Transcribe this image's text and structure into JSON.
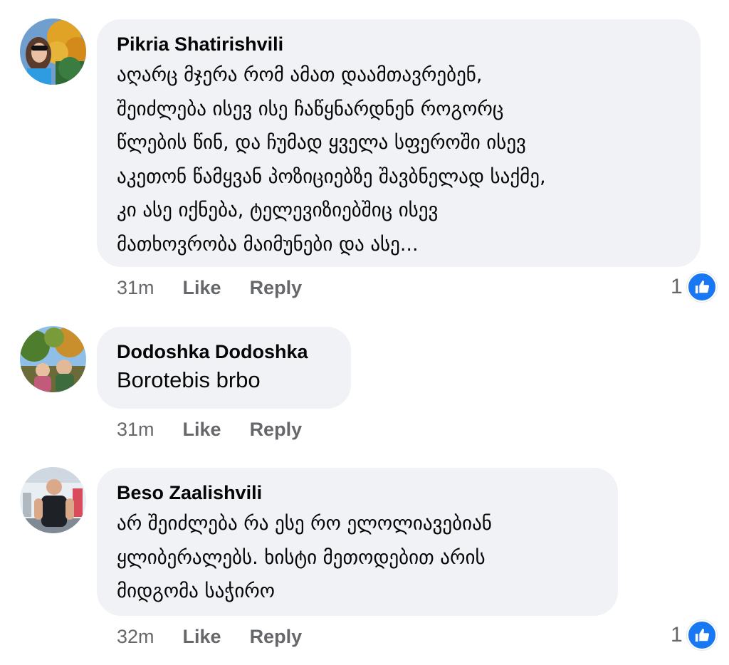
{
  "colors": {
    "bubble_bg": "#f0f2f5",
    "meta_text": "#65676b",
    "like_badge": "#1877f2"
  },
  "comments": [
    {
      "author": "Pikria Shatirishvili",
      "lines": [
        "აღარც მჯერა რომ ამათ დაამთავრებენ,",
        "შეიძლება ისევ ისე ჩაწყნარდნენ როგორც",
        "წლების წინ, და ჩუმად ყველა სფეროში ისევ",
        "აკეთონ წამყვან პოზიციებზე შავბნელად საქმე,",
        "კი ასე იქნება, ტელევიზიებშიც ისევ",
        "მათხოვრობა მაიმუნები და ასე..."
      ],
      "time": "31m",
      "like_label": "Like",
      "reply_label": "Reply",
      "reaction_count": "1",
      "reaction_icon": "thumbs-up-icon"
    },
    {
      "author": "Dodoshka Dodoshka",
      "lines": [
        "Borotebis brbo"
      ],
      "time": "31m",
      "like_label": "Like",
      "reply_label": "Reply"
    },
    {
      "author": "Beso Zaalishvili",
      "lines": [
        "არ შეიძლება რა ესე რო ელოლიავებიან",
        "ყლიბერალებს. ხისტი მეთოდებით არის",
        "მიდგომა საჭირო"
      ],
      "time": "32m",
      "like_label": "Like",
      "reply_label": "Reply",
      "reaction_count": "1",
      "reaction_icon": "thumbs-up-icon"
    }
  ]
}
